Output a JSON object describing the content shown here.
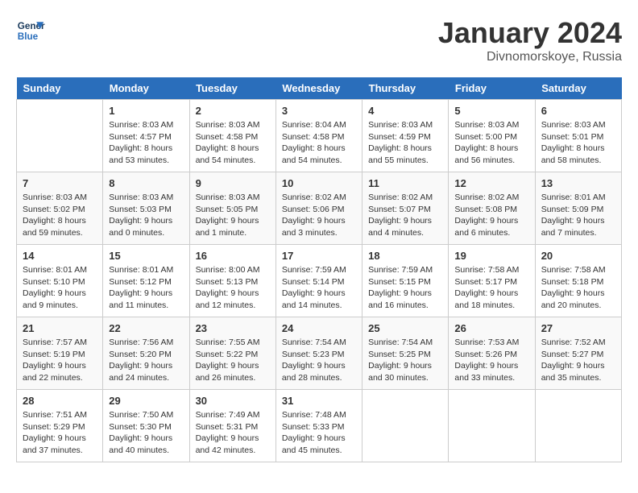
{
  "header": {
    "logo_line1": "General",
    "logo_line2": "Blue",
    "month": "January 2024",
    "location": "Divnomorskoye, Russia"
  },
  "weekdays": [
    "Sunday",
    "Monday",
    "Tuesday",
    "Wednesday",
    "Thursday",
    "Friday",
    "Saturday"
  ],
  "weeks": [
    [
      {
        "day": null
      },
      {
        "day": "1",
        "sunrise": "8:03 AM",
        "sunset": "4:57 PM",
        "daylight": "8 hours and 53 minutes."
      },
      {
        "day": "2",
        "sunrise": "8:03 AM",
        "sunset": "4:58 PM",
        "daylight": "8 hours and 54 minutes."
      },
      {
        "day": "3",
        "sunrise": "8:04 AM",
        "sunset": "4:58 PM",
        "daylight": "8 hours and 54 minutes."
      },
      {
        "day": "4",
        "sunrise": "8:03 AM",
        "sunset": "4:59 PM",
        "daylight": "8 hours and 55 minutes."
      },
      {
        "day": "5",
        "sunrise": "8:03 AM",
        "sunset": "5:00 PM",
        "daylight": "8 hours and 56 minutes."
      },
      {
        "day": "6",
        "sunrise": "8:03 AM",
        "sunset": "5:01 PM",
        "daylight": "8 hours and 58 minutes."
      }
    ],
    [
      {
        "day": "7",
        "sunrise": "8:03 AM",
        "sunset": "5:02 PM",
        "daylight": "8 hours and 59 minutes."
      },
      {
        "day": "8",
        "sunrise": "8:03 AM",
        "sunset": "5:03 PM",
        "daylight": "9 hours and 0 minutes."
      },
      {
        "day": "9",
        "sunrise": "8:03 AM",
        "sunset": "5:05 PM",
        "daylight": "9 hours and 1 minute."
      },
      {
        "day": "10",
        "sunrise": "8:02 AM",
        "sunset": "5:06 PM",
        "daylight": "9 hours and 3 minutes."
      },
      {
        "day": "11",
        "sunrise": "8:02 AM",
        "sunset": "5:07 PM",
        "daylight": "9 hours and 4 minutes."
      },
      {
        "day": "12",
        "sunrise": "8:02 AM",
        "sunset": "5:08 PM",
        "daylight": "9 hours and 6 minutes."
      },
      {
        "day": "13",
        "sunrise": "8:01 AM",
        "sunset": "5:09 PM",
        "daylight": "9 hours and 7 minutes."
      }
    ],
    [
      {
        "day": "14",
        "sunrise": "8:01 AM",
        "sunset": "5:10 PM",
        "daylight": "9 hours and 9 minutes."
      },
      {
        "day": "15",
        "sunrise": "8:01 AM",
        "sunset": "5:12 PM",
        "daylight": "9 hours and 11 minutes."
      },
      {
        "day": "16",
        "sunrise": "8:00 AM",
        "sunset": "5:13 PM",
        "daylight": "9 hours and 12 minutes."
      },
      {
        "day": "17",
        "sunrise": "7:59 AM",
        "sunset": "5:14 PM",
        "daylight": "9 hours and 14 minutes."
      },
      {
        "day": "18",
        "sunrise": "7:59 AM",
        "sunset": "5:15 PM",
        "daylight": "9 hours and 16 minutes."
      },
      {
        "day": "19",
        "sunrise": "7:58 AM",
        "sunset": "5:17 PM",
        "daylight": "9 hours and 18 minutes."
      },
      {
        "day": "20",
        "sunrise": "7:58 AM",
        "sunset": "5:18 PM",
        "daylight": "9 hours and 20 minutes."
      }
    ],
    [
      {
        "day": "21",
        "sunrise": "7:57 AM",
        "sunset": "5:19 PM",
        "daylight": "9 hours and 22 minutes."
      },
      {
        "day": "22",
        "sunrise": "7:56 AM",
        "sunset": "5:20 PM",
        "daylight": "9 hours and 24 minutes."
      },
      {
        "day": "23",
        "sunrise": "7:55 AM",
        "sunset": "5:22 PM",
        "daylight": "9 hours and 26 minutes."
      },
      {
        "day": "24",
        "sunrise": "7:54 AM",
        "sunset": "5:23 PM",
        "daylight": "9 hours and 28 minutes."
      },
      {
        "day": "25",
        "sunrise": "7:54 AM",
        "sunset": "5:25 PM",
        "daylight": "9 hours and 30 minutes."
      },
      {
        "day": "26",
        "sunrise": "7:53 AM",
        "sunset": "5:26 PM",
        "daylight": "9 hours and 33 minutes."
      },
      {
        "day": "27",
        "sunrise": "7:52 AM",
        "sunset": "5:27 PM",
        "daylight": "9 hours and 35 minutes."
      }
    ],
    [
      {
        "day": "28",
        "sunrise": "7:51 AM",
        "sunset": "5:29 PM",
        "daylight": "9 hours and 37 minutes."
      },
      {
        "day": "29",
        "sunrise": "7:50 AM",
        "sunset": "5:30 PM",
        "daylight": "9 hours and 40 minutes."
      },
      {
        "day": "30",
        "sunrise": "7:49 AM",
        "sunset": "5:31 PM",
        "daylight": "9 hours and 42 minutes."
      },
      {
        "day": "31",
        "sunrise": "7:48 AM",
        "sunset": "5:33 PM",
        "daylight": "9 hours and 45 minutes."
      },
      {
        "day": null
      },
      {
        "day": null
      },
      {
        "day": null
      }
    ]
  ]
}
